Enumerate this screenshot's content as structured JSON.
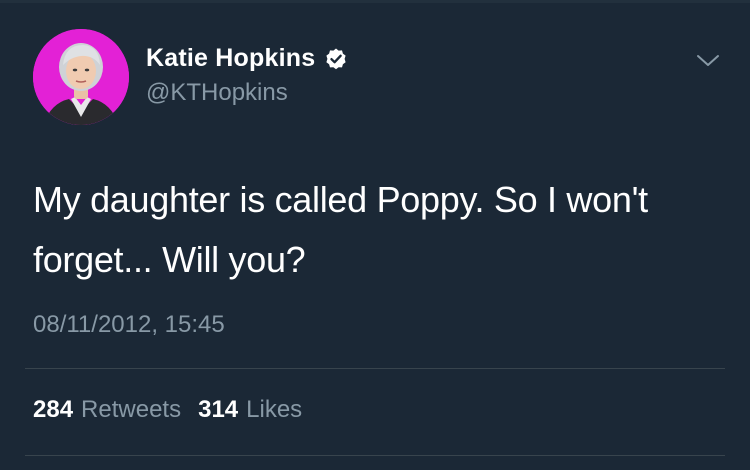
{
  "tweet": {
    "author": {
      "display_name": "Katie Hopkins",
      "handle": "@KTHopkins",
      "verified": true,
      "avatar_bg_color": "#e321d6"
    },
    "text": "My daughter is called Poppy. So I won't forget... Will you?",
    "timestamp": "08/11/2012, 15:45",
    "stats": {
      "retweets_count": "284",
      "retweets_label": "Retweets",
      "likes_count": "314",
      "likes_label": "Likes"
    },
    "icons": {
      "verified": "verified-badge-icon",
      "menu": "chevron-down-icon"
    },
    "colors": {
      "background": "#1b2836",
      "primary_text": "#ffffff",
      "secondary_text": "#8899a6",
      "divider": "#38444d"
    }
  }
}
